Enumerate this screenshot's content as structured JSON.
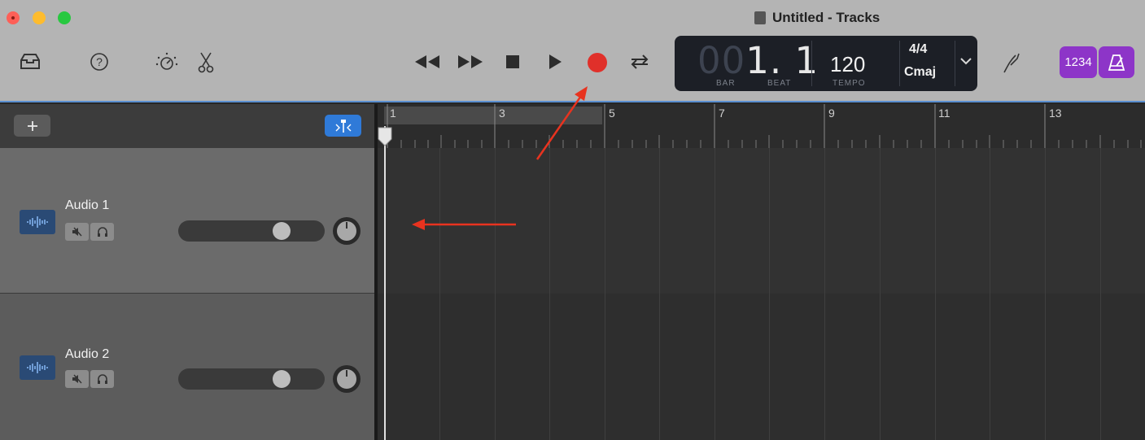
{
  "window": {
    "title": "Untitled - Tracks"
  },
  "lcd": {
    "bar_dim": "00",
    "bar_beat": "1. 1",
    "bar_label": "BAR",
    "beat_label": "BEAT",
    "tempo": "120",
    "tempo_label": "TEMPO",
    "time_signature": "4/4",
    "key": "Cmaj"
  },
  "toolbar": {
    "count_in_label": "1234",
    "icons": [
      "library-icon",
      "help-icon",
      "smart-controls-icon",
      "editors-icon",
      "rewind-icon",
      "forward-icon",
      "stop-icon",
      "play-icon",
      "record-icon",
      "cycle-icon",
      "tuner-icon",
      "metronome-icon"
    ]
  },
  "ruler": {
    "markers": [
      "1",
      "3",
      "5",
      "7",
      "9",
      "11",
      "13"
    ]
  },
  "tracks": [
    {
      "name": "Audio 1"
    },
    {
      "name": "Audio 2"
    }
  ],
  "colors": {
    "record": "#e0302a",
    "accent_purple": "#8d35c8",
    "smart_blue": "#2f7ad8",
    "annotation": "#e8331f"
  }
}
